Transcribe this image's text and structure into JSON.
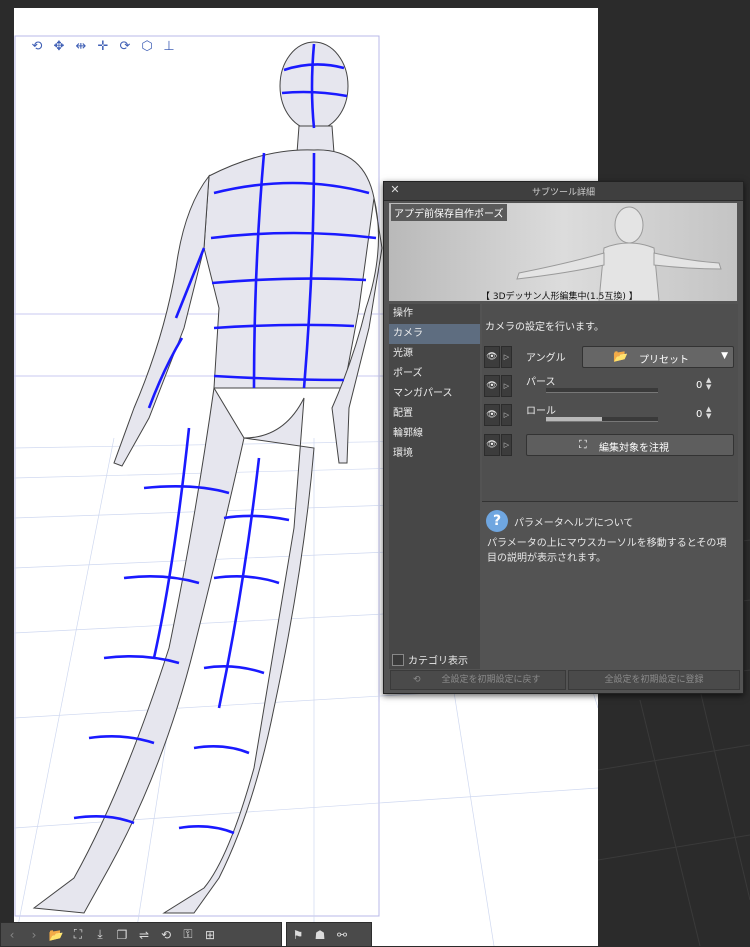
{
  "camera_icons": [
    "rotate-camera-icon",
    "pan-camera-icon",
    "dolly-camera-icon",
    "move-object-icon",
    "rotate-object-icon",
    "cube-icon",
    "move-ground-icon"
  ],
  "subtool_panel": {
    "title": "サブツール詳細",
    "preview": {
      "tag": "アプデ前保存自作ポーズ",
      "caption": "【 3Dデッサン人形編集中(1.5互換) 】"
    },
    "categories": [
      {
        "label": "操作",
        "active": false
      },
      {
        "label": "カメラ",
        "active": true
      },
      {
        "label": "光源",
        "active": false
      },
      {
        "label": "ポーズ",
        "active": false
      },
      {
        "label": "マンガパース",
        "active": false
      },
      {
        "label": "配置",
        "active": false
      },
      {
        "label": "輪郭線",
        "active": false
      },
      {
        "label": "環境",
        "active": false
      }
    ],
    "category_toggle_label": "カテゴリ表示",
    "description": "カメラの設定を行います。",
    "params": {
      "angle_label": "アングル",
      "preset_label": "プリセット",
      "perspective_label": "パース",
      "perspective_value": "0",
      "perspective_fill": 0,
      "roll_label": "ロール",
      "roll_value": "0",
      "roll_fill": 0.5,
      "focus_label": "編集対象を注視"
    },
    "help": {
      "heading": "パラメータヘルプについて",
      "body": "パラメータの上にマウスカーソルを移動するとその項目の説明が表示されます。"
    },
    "reset_label": "全設定を初期設定に戻す",
    "register_label": "全設定を初期設定に登録"
  },
  "colors": {
    "active_category": "#5e6d80",
    "wireframe": "#1a1aff",
    "help_icon": "#6fa6e0"
  }
}
